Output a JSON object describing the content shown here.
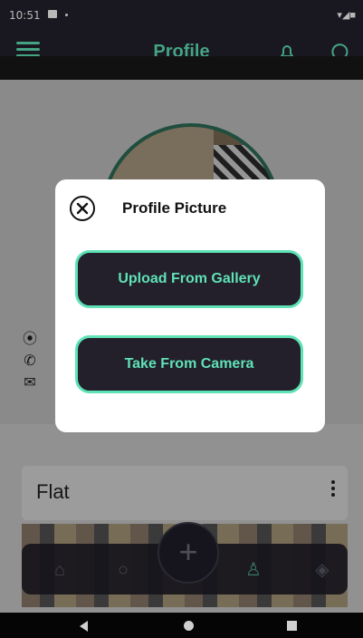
{
  "status_bar": {
    "time": "10:51",
    "right_icons": "▾◢■"
  },
  "app_bar": {
    "title": "Profile"
  },
  "dialog": {
    "title": "Profile Picture",
    "upload_label": "Upload From Gallery",
    "camera_label": "Take From Camera"
  },
  "card": {
    "name": "Flat"
  },
  "contacts": {
    "icons": [
      "location-icon",
      "phone-icon",
      "email-icon"
    ]
  },
  "colors": {
    "accent": "#5fe2b6",
    "dark": "#23202b"
  }
}
